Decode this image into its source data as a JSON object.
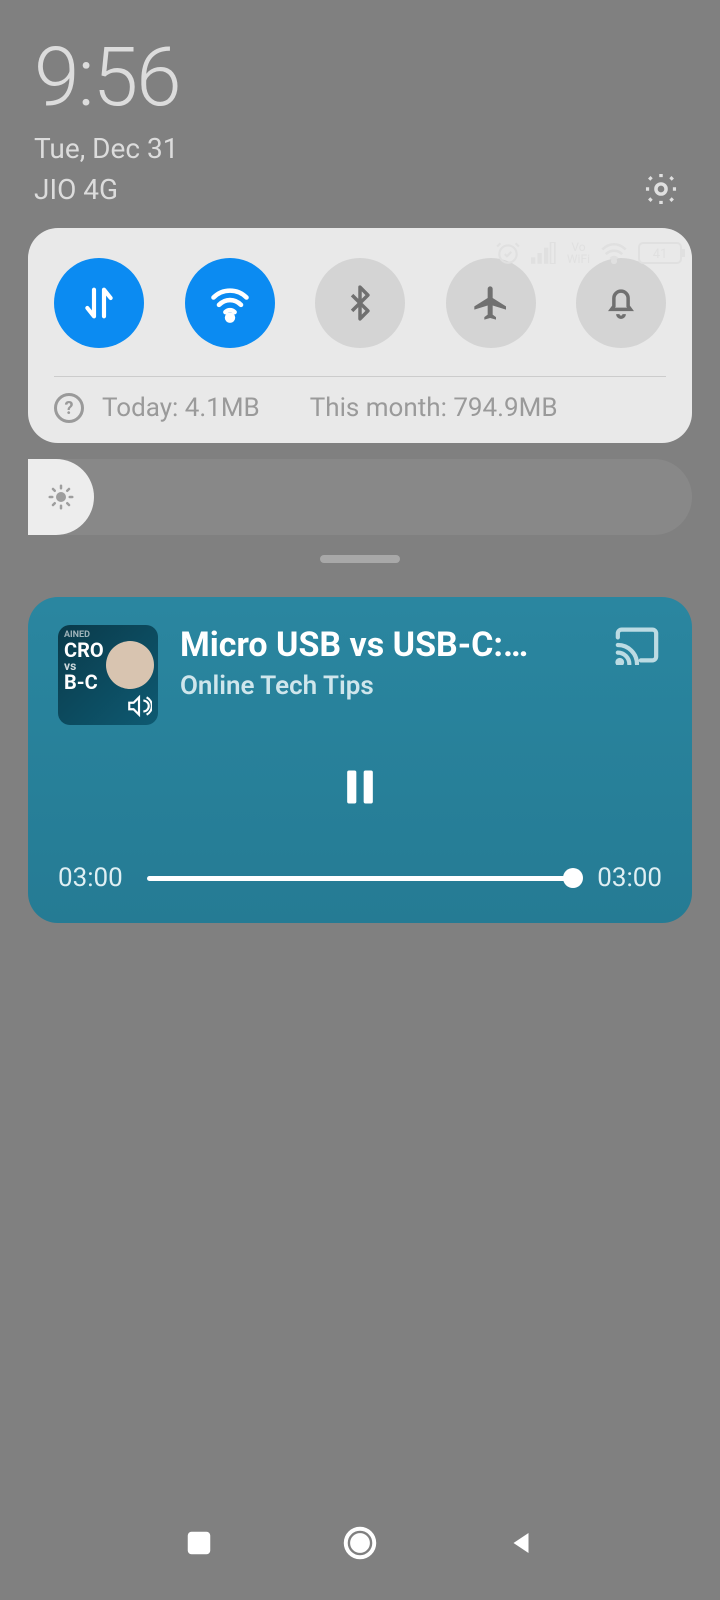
{
  "header": {
    "time": "9:56",
    "date": "Tue, Dec 31",
    "carrier": "JIO 4G",
    "battery": "41",
    "vowifi": "Vo WiFi"
  },
  "toggles": {
    "data": true,
    "wifi": true,
    "bluetooth": false,
    "airplane": false,
    "dnd": false
  },
  "usage": {
    "today_label": "Today: 4.1MB",
    "month_label": "This month: 794.9MB"
  },
  "media": {
    "title": "Micro USB vs USB-C:…",
    "source": "Online Tech Tips",
    "thumb_text_1": "CRO",
    "thumb_text_2": "B-C",
    "elapsed": "03:00",
    "duration": "03:00"
  }
}
